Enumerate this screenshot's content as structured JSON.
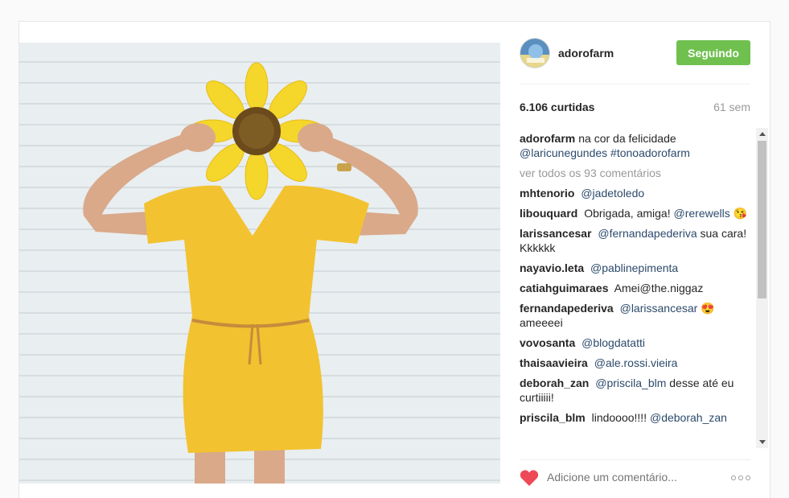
{
  "post": {
    "username": "adorofarm",
    "follow_label": "Seguindo",
    "likes": "6.106 curtidas",
    "age": "61 sem"
  },
  "caption": {
    "user": "adorofarm",
    "text": "na cor da felicidade",
    "tags": "@laricunegundes #tonoadorofarm"
  },
  "view_all": "ver todos os 93 comentários",
  "comments": [
    {
      "user": "mhtenorio",
      "text": "",
      "mention": "@jadetoledo",
      "tail": ""
    },
    {
      "user": "libouquard",
      "text": "Obrigada, amiga!",
      "mention": "@rerewells",
      "tail": "😘"
    },
    {
      "user": "larissancesar",
      "text": "",
      "mention": "@fernandapederiva",
      "tail": "sua cara! Kkkkkk"
    },
    {
      "user": "nayavio.leta",
      "text": "",
      "mention": "@pablinepimenta",
      "tail": ""
    },
    {
      "user": "catiahguimaraes",
      "text": "Amei@the.niggaz",
      "mention": "",
      "tail": ""
    },
    {
      "user": "fernandapederiva",
      "text": "",
      "mention": "@larissancesar",
      "tail": "😍 ameeeei"
    },
    {
      "user": "vovosanta",
      "text": "",
      "mention": "@blogdatatti",
      "tail": ""
    },
    {
      "user": "thaisaavieira",
      "text": "",
      "mention": "@ale.rossi.vieira",
      "tail": ""
    },
    {
      "user": "deborah_zan",
      "text": "",
      "mention": "@priscila_blm",
      "tail": "desse até eu curtiiiii!"
    },
    {
      "user": "priscila_blm",
      "text": "lindoooo!!!!",
      "mention": "@deborah_zan",
      "tail": ""
    }
  ],
  "footer": {
    "comment_placeholder": "Adicione um comentário..."
  },
  "colors": {
    "follow_green": "#70c050",
    "mention_blue": "#2c4a6b",
    "heart_red": "#ed4956"
  },
  "icons": {
    "like": "heart-icon",
    "options": "more-options-icon"
  }
}
